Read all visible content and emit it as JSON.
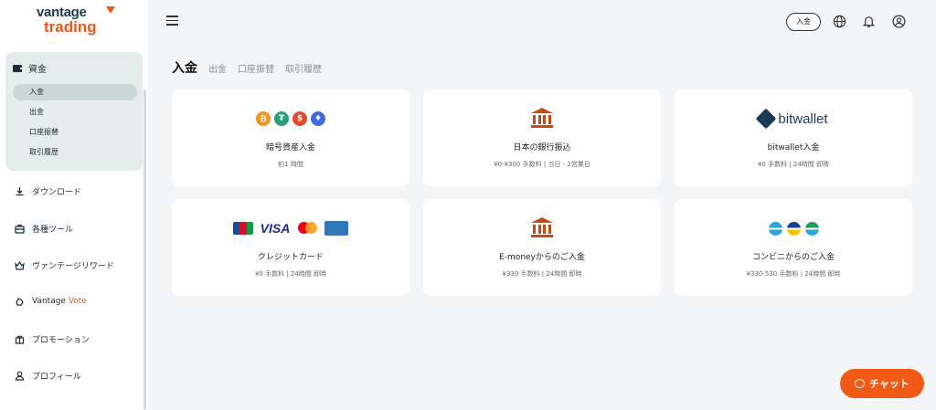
{
  "brand": {
    "line1": "vantage",
    "line2": "trading",
    "accent": "#e55b20",
    "navy": "#1b3a57"
  },
  "sidebar": {
    "group_label": "資金",
    "sub_items": [
      "入金",
      "出金",
      "口座振替",
      "取引履歴"
    ],
    "nav": [
      {
        "label": "ダウンロード",
        "icon": "download-icon"
      },
      {
        "label": "各種ツール",
        "icon": "toolbox-icon"
      },
      {
        "label": "ヴァンテージリワード",
        "icon": "reward-icon"
      },
      {
        "label_a": "Vantage ",
        "label_b": "Vote",
        "icon": "vote-icon"
      },
      {
        "label": "プロモーション",
        "icon": "gift-icon"
      },
      {
        "label": "プロフィール",
        "icon": "user-icon"
      }
    ]
  },
  "topbar": {
    "deposit_label": "入金"
  },
  "tabs": [
    "入金",
    "出金",
    "口座振替",
    "取引履歴"
  ],
  "cards": [
    {
      "title": "暗号資産入金",
      "info": "約1 時間"
    },
    {
      "title": "日本の銀行振込",
      "info": "¥0-¥300   手数料   | 当日 - 2営業日"
    },
    {
      "title": "bitwallet入金",
      "info": "¥0   手数料   | 24時間   即時",
      "logo_text": "bitwallet"
    },
    {
      "title": "クレジットカード",
      "info": "¥0   手数料   | 24時間   即時"
    },
    {
      "title": "E-moneyからのご入金",
      "info": "¥330   手数料   | 24時間   即時"
    },
    {
      "title": "コンビニからのご入金",
      "info": "¥330-530   手数料   | 24時間   即時"
    }
  ],
  "card_logos": {
    "visa": "VISA"
  },
  "chat": {
    "label": "チャット"
  }
}
